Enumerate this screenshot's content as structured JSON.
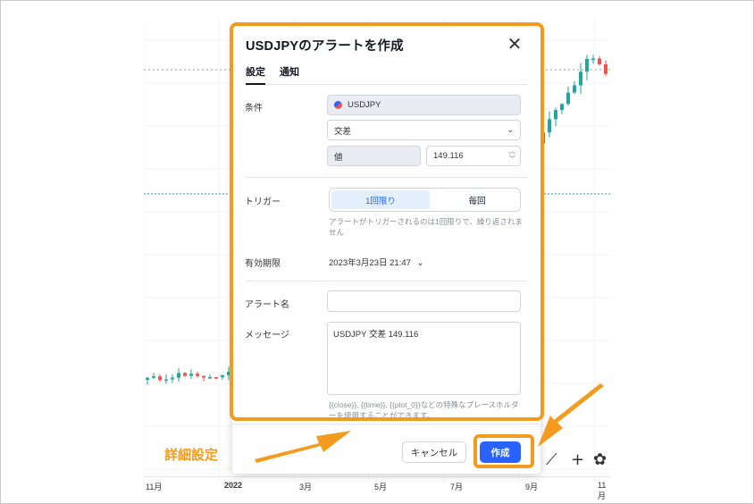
{
  "dialog": {
    "title": "USDJPYのアラートを作成",
    "tabs": [
      "設定",
      "通知"
    ],
    "condition_label": "条件",
    "symbol": "USDJPY",
    "operator": "交差",
    "value_source": "値",
    "value": "149.116",
    "trigger_label": "トリガー",
    "trigger_options": [
      "1回限り",
      "毎回"
    ],
    "trigger_selected": "1回限り",
    "trigger_hint": "アラートがトリガーされるのは1回限りで、繰り返されません",
    "expiry_label": "有効期限",
    "expiry_value": "2023年3月23日 21:47",
    "alert_name_label": "アラート名",
    "alert_name_value": "",
    "message_label": "メッセージ",
    "message_value": "USDJPY 交差 149.116",
    "placeholder_hint": "{{close}}, {{time}}, {{plot_0}}などの特殊なプレースホルダーを使用することができます。",
    "cancel_label": "キャンセル",
    "create_label": "作成"
  },
  "chart": {
    "x_ticks": [
      "11月",
      "2022",
      "3月",
      "5月",
      "7月",
      "9月",
      "11月"
    ]
  },
  "annotation": {
    "label": "詳細設定",
    "color": "#f29b1f"
  },
  "colors": {
    "accent": "#2962ff",
    "up": "#26a69a",
    "down": "#ef5350",
    "highlight": "#f29b1f"
  }
}
